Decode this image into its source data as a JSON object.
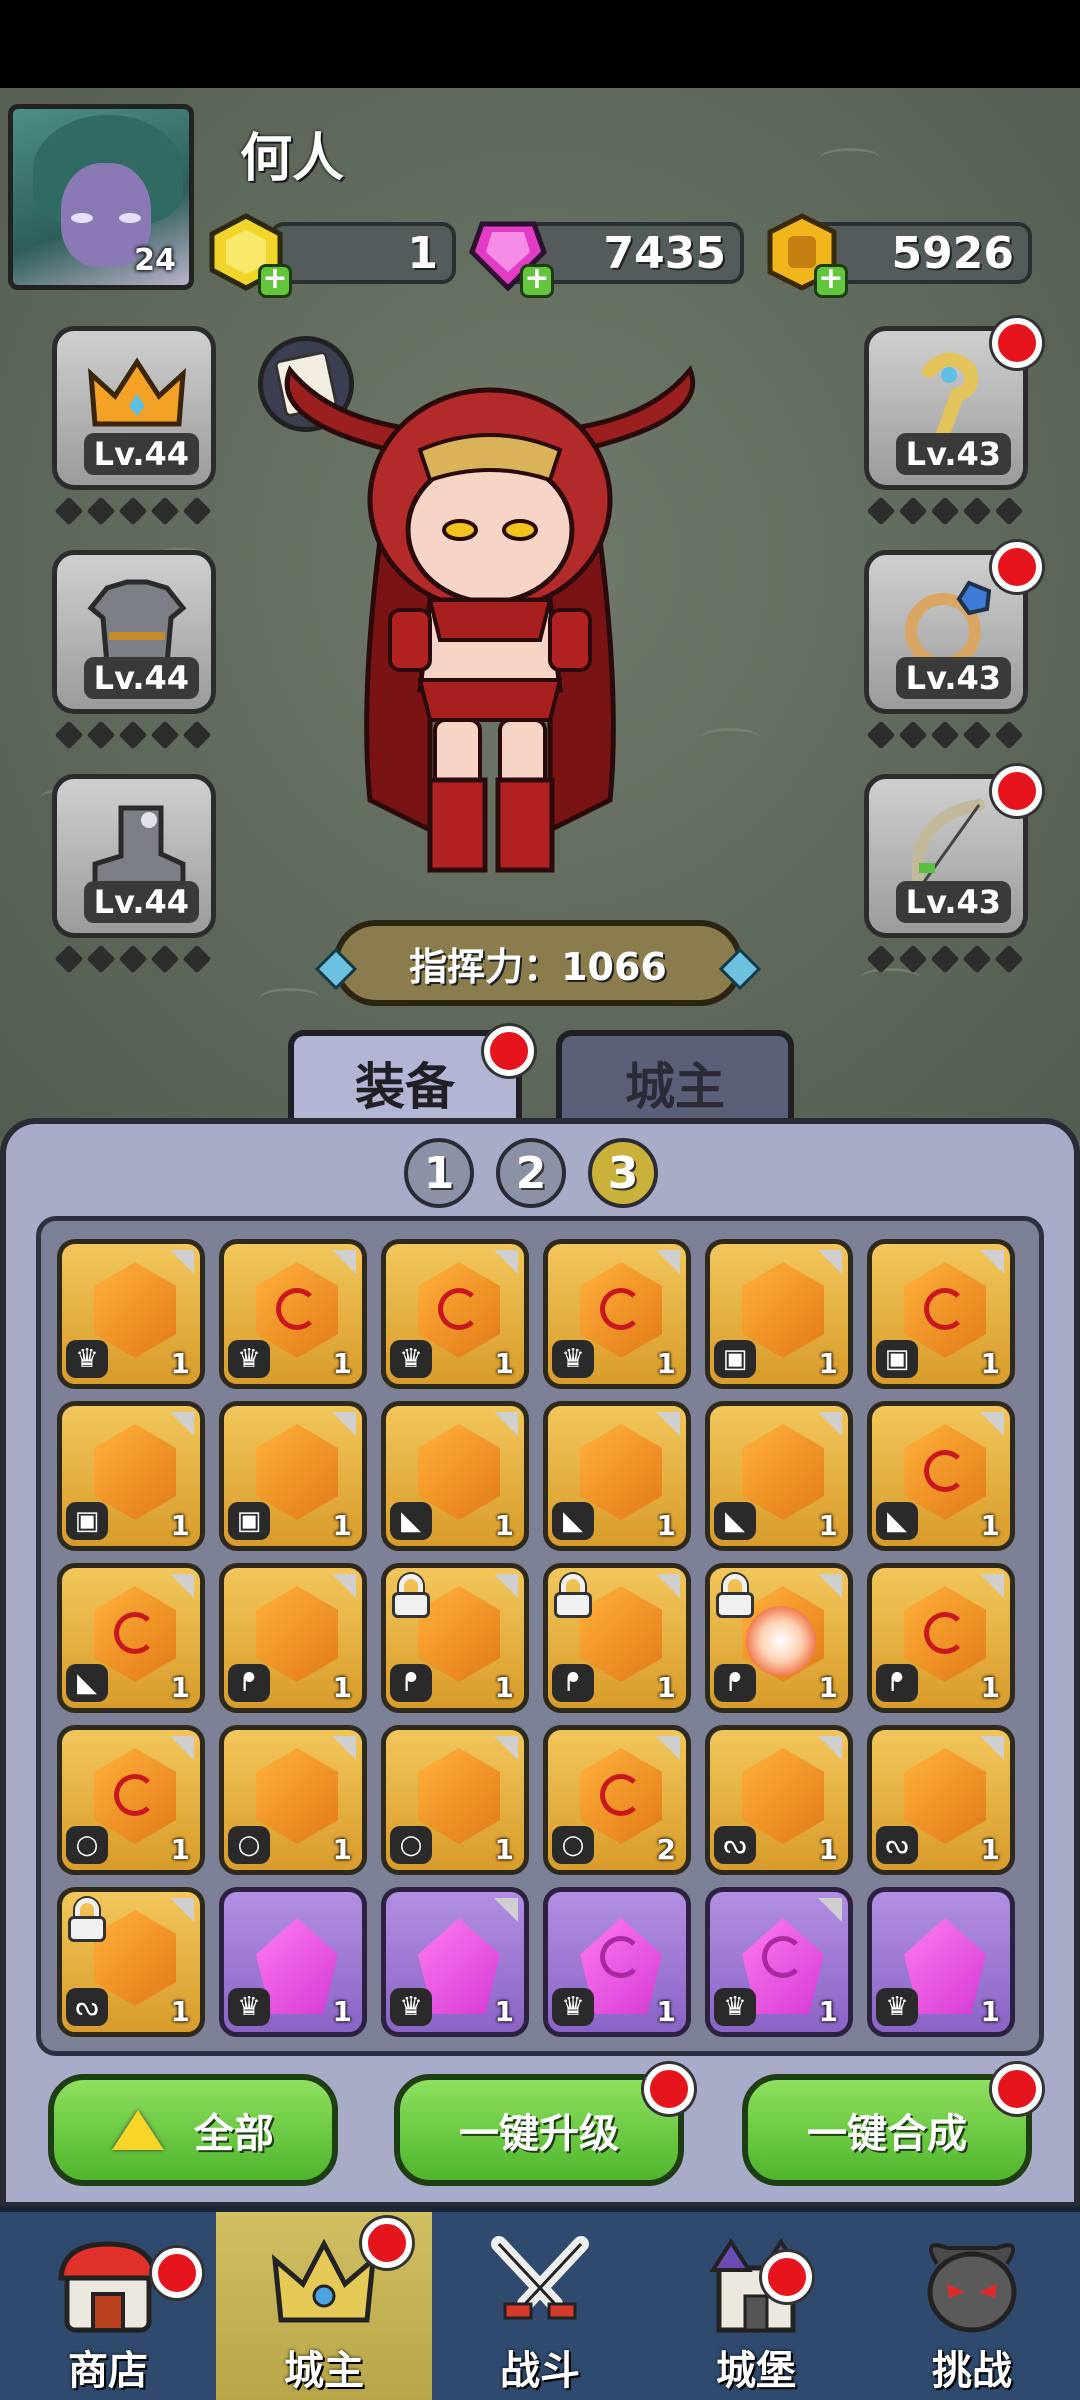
{
  "player": {
    "name": "何人",
    "level": "24"
  },
  "currencies": [
    {
      "name": "gold-gem",
      "value": "1",
      "color": "#f2d52a"
    },
    {
      "name": "pink-gem",
      "value": "7435",
      "color": "#e23cc7"
    },
    {
      "name": "gold-coin",
      "value": "5926",
      "color": "#f0b61c"
    }
  ],
  "equipment": {
    "left": [
      {
        "name": "crown",
        "level": "Lv.44"
      },
      {
        "name": "armor",
        "level": "Lv.44"
      },
      {
        "name": "boots",
        "level": "Lv.44"
      }
    ],
    "right": [
      {
        "name": "staff",
        "level": "Lv.43"
      },
      {
        "name": "ring",
        "level": "Lv.43"
      },
      {
        "name": "bow",
        "level": "Lv.43"
      }
    ]
  },
  "power": {
    "label": "指挥力：1066"
  },
  "tabs": {
    "equip": "装备",
    "lord": "城主"
  },
  "pages": [
    "1",
    "2",
    "3"
  ],
  "inventory": [
    {
      "c": "gold",
      "s": false,
      "t": "♛",
      "q": "1",
      "l": false
    },
    {
      "c": "gold",
      "s": true,
      "t": "♛",
      "q": "1",
      "l": false
    },
    {
      "c": "gold",
      "s": true,
      "t": "♛",
      "q": "1",
      "l": false
    },
    {
      "c": "gold",
      "s": true,
      "t": "♛",
      "q": "1",
      "l": false
    },
    {
      "c": "gold",
      "s": false,
      "t": "▣",
      "q": "1",
      "l": false
    },
    {
      "c": "gold",
      "s": true,
      "t": "▣",
      "q": "1",
      "l": false
    },
    {
      "c": "gold",
      "s": false,
      "t": "▣",
      "q": "1",
      "l": false
    },
    {
      "c": "gold",
      "s": false,
      "t": "▣",
      "q": "1",
      "l": false
    },
    {
      "c": "gold",
      "s": false,
      "t": "◣",
      "q": "1",
      "l": false
    },
    {
      "c": "gold",
      "s": false,
      "t": "◣",
      "q": "1",
      "l": false
    },
    {
      "c": "gold",
      "s": false,
      "t": "◣",
      "q": "1",
      "l": false
    },
    {
      "c": "gold",
      "s": true,
      "t": "◣",
      "q": "1",
      "l": false
    },
    {
      "c": "gold",
      "s": true,
      "t": "◣",
      "q": "1",
      "l": false
    },
    {
      "c": "gold",
      "s": false,
      "t": "ᖰ",
      "q": "1",
      "l": false
    },
    {
      "c": "gold",
      "s": false,
      "t": "ᖰ",
      "q": "1",
      "l": true
    },
    {
      "c": "gold",
      "s": false,
      "t": "ᖰ",
      "q": "1",
      "l": true
    },
    {
      "c": "gold",
      "s": false,
      "t": "ᖰ",
      "q": "1",
      "l": true,
      "b": true
    },
    {
      "c": "gold",
      "s": true,
      "t": "ᖰ",
      "q": "1",
      "l": false
    },
    {
      "c": "gold",
      "s": true,
      "t": "○",
      "q": "1",
      "l": false
    },
    {
      "c": "gold",
      "s": false,
      "t": "○",
      "q": "1",
      "l": false
    },
    {
      "c": "gold",
      "s": false,
      "t": "○",
      "q": "1",
      "l": false
    },
    {
      "c": "gold",
      "s": true,
      "t": "○",
      "q": "2",
      "l": false
    },
    {
      "c": "gold",
      "s": false,
      "t": "ᔓ",
      "q": "1",
      "l": false
    },
    {
      "c": "gold",
      "s": false,
      "t": "ᔓ",
      "q": "1",
      "l": false
    },
    {
      "c": "gold",
      "s": false,
      "t": "ᔓ",
      "q": "1",
      "l": true
    },
    {
      "c": "purple",
      "s": false,
      "t": "♛",
      "q": "1",
      "l": false
    },
    {
      "c": "purple",
      "s": false,
      "t": "♛",
      "q": "1",
      "l": false
    },
    {
      "c": "purple",
      "s": true,
      "t": "♛",
      "q": "1",
      "l": false
    },
    {
      "c": "purple",
      "s": true,
      "t": "♛",
      "q": "1",
      "l": false
    },
    {
      "c": "purple",
      "s": false,
      "t": "♛",
      "q": "1",
      "l": false
    }
  ],
  "actions": {
    "all": "全部",
    "upgrade": "一键升级",
    "merge": "一键合成"
  },
  "nav": [
    {
      "label": "商店",
      "icon": "shop-icon"
    },
    {
      "label": "城主",
      "icon": "crown-icon"
    },
    {
      "label": "战斗",
      "icon": "swords-icon"
    },
    {
      "label": "城堡",
      "icon": "castle-icon"
    },
    {
      "label": "挑战",
      "icon": "demon-icon"
    }
  ]
}
